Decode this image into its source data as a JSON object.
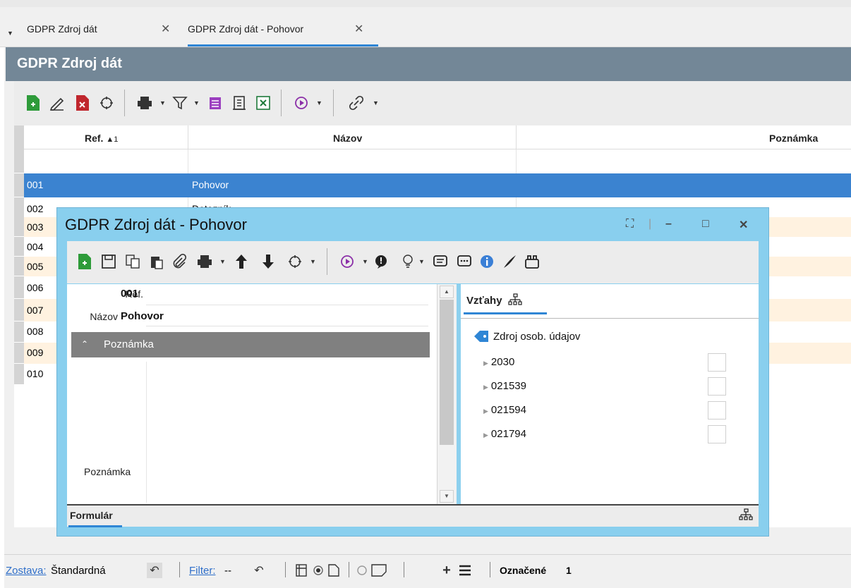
{
  "tabs": [
    {
      "label": "GDPR Zdroj dát",
      "close": "✕"
    },
    {
      "label": "GDPR Zdroj dát - Pohovor",
      "close": "✕"
    }
  ],
  "main": {
    "title": "GDPR Zdroj dát",
    "columns": {
      "ref": "Ref.",
      "ref_sort": "▲1",
      "name": "Názov",
      "note": "Poznámka"
    },
    "rows": [
      {
        "ref": "",
        "name": ""
      },
      {
        "ref": "001",
        "name": "Pohovor"
      },
      {
        "ref": "002",
        "name": "Dotazník"
      },
      {
        "ref": "003",
        "name": ""
      },
      {
        "ref": "004",
        "name": ""
      },
      {
        "ref": "005",
        "name": ""
      },
      {
        "ref": "006",
        "name": ""
      },
      {
        "ref": "007",
        "name": ""
      },
      {
        "ref": "008",
        "name": ""
      },
      {
        "ref": "009",
        "name": ""
      },
      {
        "ref": "010",
        "name": ""
      }
    ]
  },
  "dialog": {
    "title": "GDPR Zdroj dát - Pohovor",
    "fields": {
      "ref_label": "Ref.",
      "ref_value": "001",
      "name_label": "Názov",
      "name_value": "Pohovor"
    },
    "note_section": "Poznámka",
    "note_label": "Poznámka",
    "right_tab": "Vzťahy",
    "tree": {
      "root": "Zdroj osob. údajov",
      "items": [
        "2030",
        "021539",
        "021594",
        "021794"
      ]
    },
    "footer_tab": "Formulár"
  },
  "statusbar": {
    "zostava_label": "Zostava:",
    "zostava_value": "Štandardná",
    "filter_label": "Filter:",
    "filter_value": "--",
    "oznacene_label": "Označené",
    "oznacene_value": "1"
  },
  "colors": {
    "selected_row": "#3b83d0",
    "alt_row": "#fff2e0",
    "title_band": "#738797",
    "dialog_frame": "#89cfee",
    "accent": "#2f86d5"
  }
}
